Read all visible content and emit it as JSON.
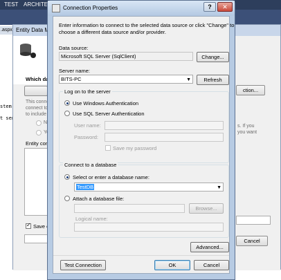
{
  "ide": {
    "menu": [
      "TEST",
      "ARCHITECT"
    ],
    "doc_tab": ".aspx",
    "code_lines": [
      "stem.",
      "t sen"
    ]
  },
  "wizard": {
    "title": "Entity Data Mo",
    "which_data": "Which data",
    "connect_text": [
      "This conne",
      "connect to",
      "to include"
    ],
    "radio_no": "No",
    "radio_yes": "Ye",
    "entity_conn": "Entity conn",
    "save_label": "Save ent",
    "new_connection_btn": "ction...",
    "right_text": [
      "s. If you",
      "you want"
    ],
    "cancel_btn": "Cancel"
  },
  "dialog": {
    "title": "Connection Properties",
    "help_glyph": "?",
    "close_glyph": "✕",
    "intro": [
      "Enter information to connect to the selected data source or click \"Change\" to",
      "choose a different data source and/or provider."
    ],
    "data_source_label": "Data source:",
    "data_source_value": "Microsoft SQL Server (SqlClient)",
    "change_btn": "Change...",
    "server_name_label": "Server name:",
    "server_name_value": "BITS-PC",
    "refresh_btn": "Refresh",
    "logon_group": "Log on to the server",
    "windows_auth": "Use Windows Authentication",
    "sql_auth": "Use SQL Server Authentication",
    "username_label": "User name:",
    "password_label": "Password:",
    "save_password": "Save my password",
    "connect_group": "Connect to a database",
    "select_db_label": "Select or enter a database name:",
    "db_name_value": "TestDB",
    "attach_label": "Attach a database file:",
    "browse_btn": "Browse...",
    "logical_name_label": "Logical name:",
    "advanced_btn": "Advanced...",
    "test_btn": "Test Connection",
    "ok_btn": "OK",
    "cancel_btn": "Cancel"
  }
}
